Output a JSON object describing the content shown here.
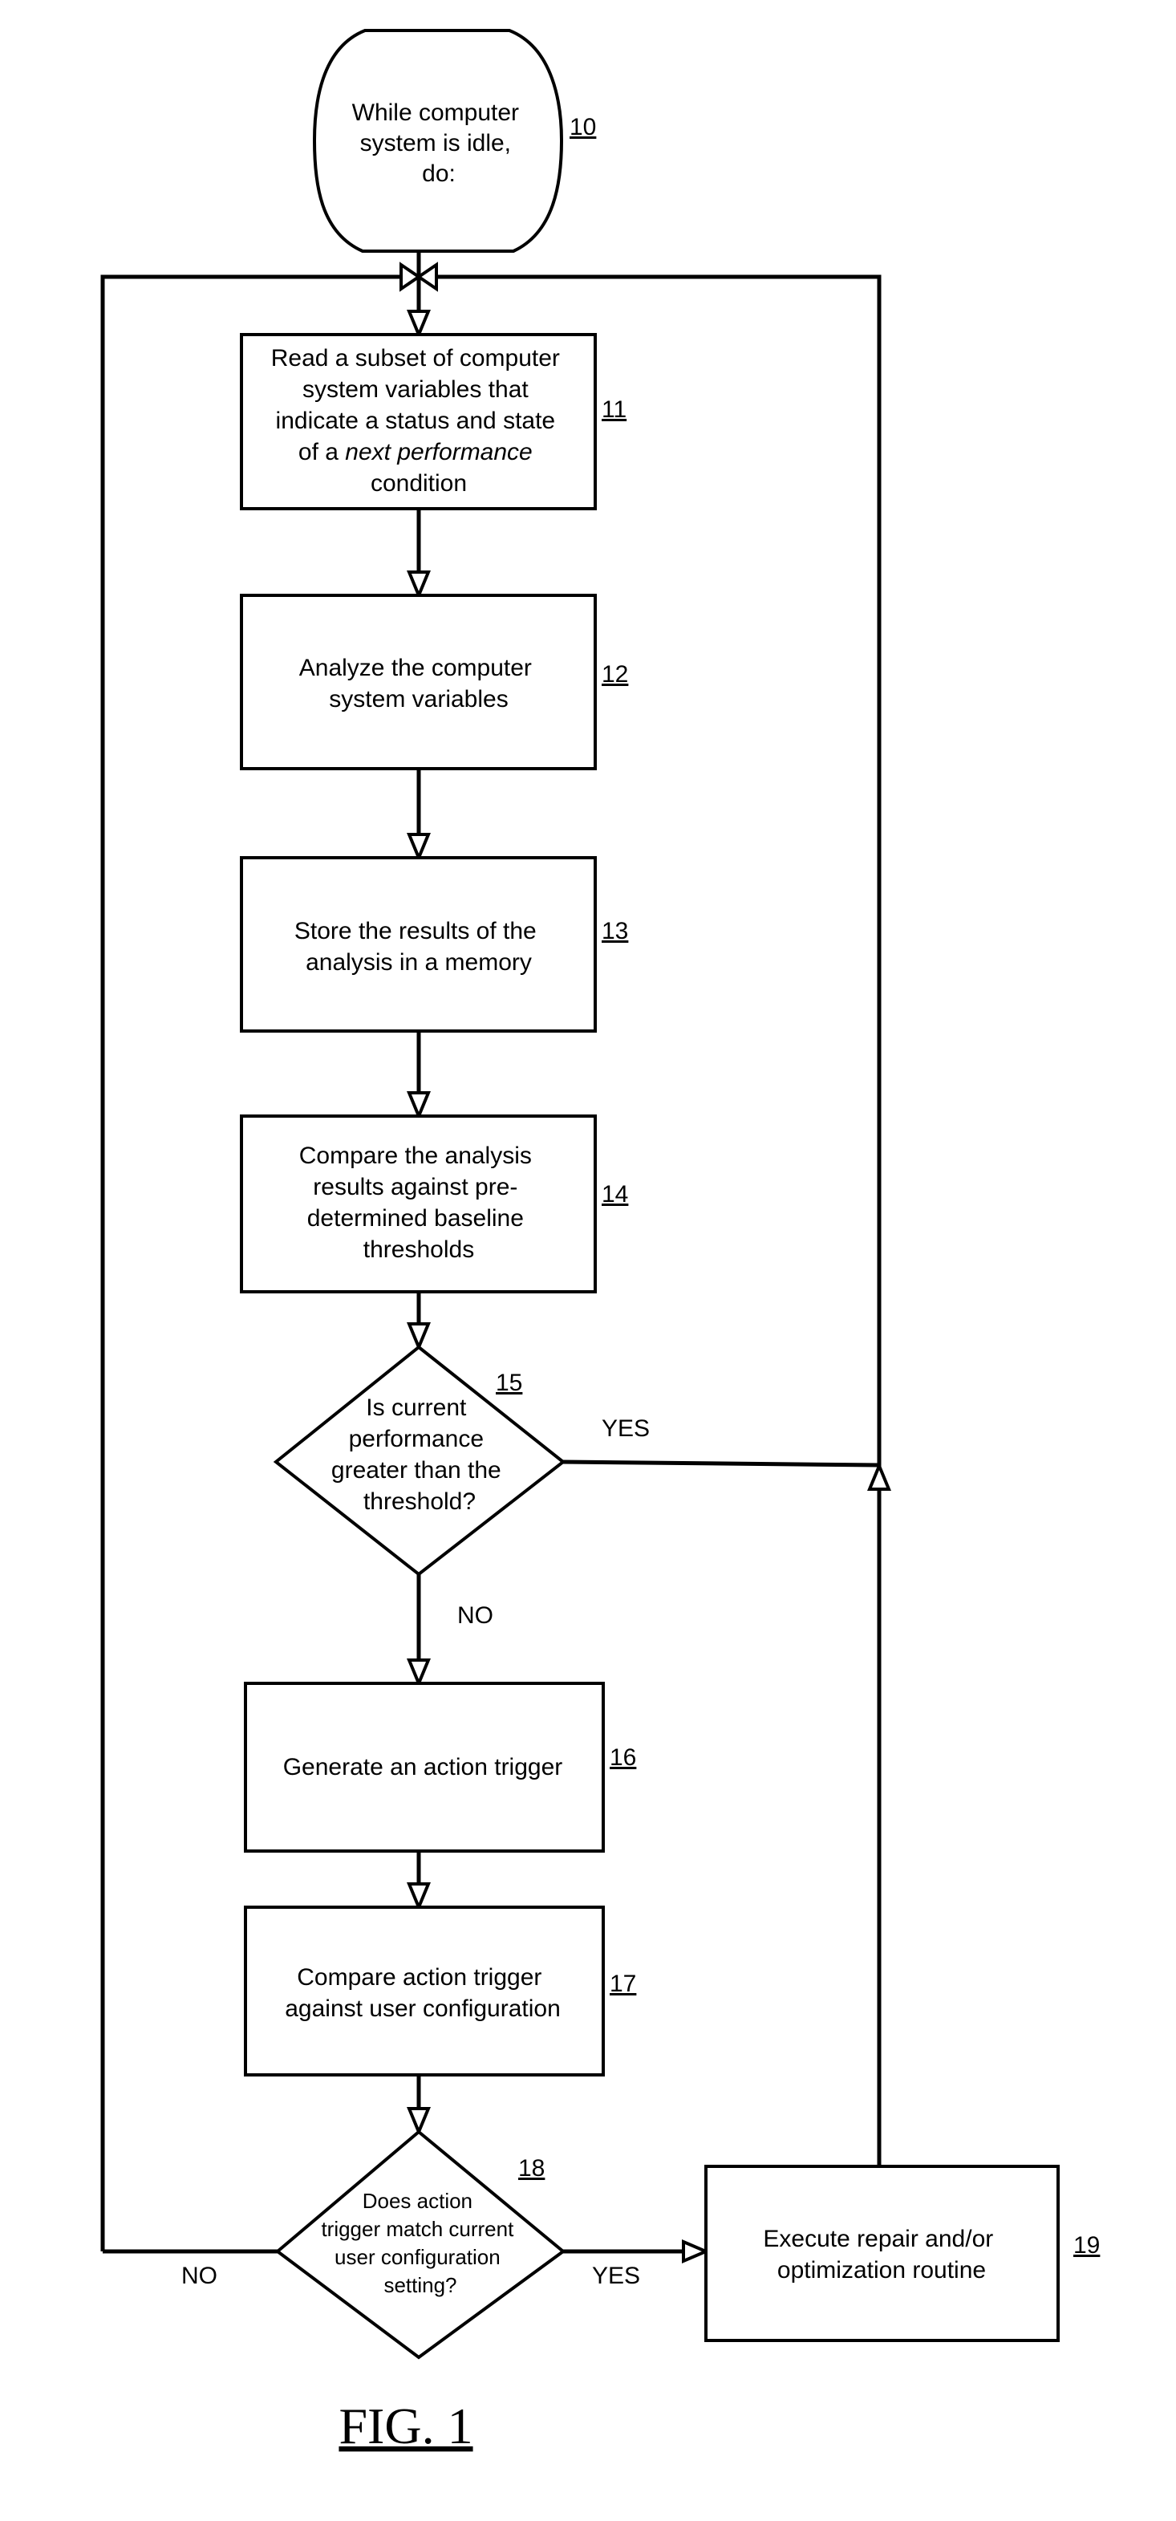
{
  "figure": {
    "title": "FIG. 1"
  },
  "nodes": [
    {
      "id": "10",
      "type": "terminal",
      "ref": "10",
      "lines": [
        "While computer",
        "system is idle,",
        "do:"
      ]
    },
    {
      "id": "11",
      "type": "process",
      "ref": "11",
      "lines": [
        "Read a subset of computer",
        "system variables that",
        "indicate a status and state",
        "of a next performance",
        "condition"
      ],
      "italic_phrase": "next performance"
    },
    {
      "id": "12",
      "type": "process",
      "ref": "12",
      "lines": [
        "Analyze the computer",
        "system variables"
      ]
    },
    {
      "id": "13",
      "type": "process",
      "ref": "13",
      "lines": [
        "Store the results of the",
        "analysis in a memory"
      ]
    },
    {
      "id": "14",
      "type": "process",
      "ref": "14",
      "lines": [
        "Compare the analysis",
        "results against pre-",
        "determined baseline",
        "thresholds"
      ]
    },
    {
      "id": "15",
      "type": "decision",
      "ref": "15",
      "lines": [
        "Is current",
        "performance",
        "greater than the",
        "threshold?"
      ]
    },
    {
      "id": "16",
      "type": "process",
      "ref": "16",
      "lines": [
        "Generate an action trigger"
      ]
    },
    {
      "id": "17",
      "type": "process",
      "ref": "17",
      "lines": [
        "Compare action trigger",
        "against user configuration"
      ]
    },
    {
      "id": "18",
      "type": "decision",
      "ref": "18",
      "lines": [
        "Does action",
        "trigger match current",
        "user configuration",
        "setting?"
      ]
    },
    {
      "id": "19",
      "type": "process",
      "ref": "19",
      "lines": [
        "Execute repair and/or",
        "optimization routine"
      ]
    }
  ],
  "edge_labels": {
    "d15_yes": "YES",
    "d15_no": "NO",
    "d18_no": "NO",
    "d18_yes": "YES"
  },
  "edges": [
    {
      "from": "10",
      "to": "11"
    },
    {
      "from": "11",
      "to": "12"
    },
    {
      "from": "12",
      "to": "13"
    },
    {
      "from": "13",
      "to": "14"
    },
    {
      "from": "14",
      "to": "15"
    },
    {
      "from": "15",
      "to": "loop",
      "label": "YES"
    },
    {
      "from": "15",
      "to": "16",
      "label": "NO"
    },
    {
      "from": "16",
      "to": "17"
    },
    {
      "from": "17",
      "to": "18"
    },
    {
      "from": "18",
      "to": "loop",
      "label": "NO"
    },
    {
      "from": "18",
      "to": "19",
      "label": "YES"
    },
    {
      "from": "19",
      "to": "loop"
    }
  ]
}
